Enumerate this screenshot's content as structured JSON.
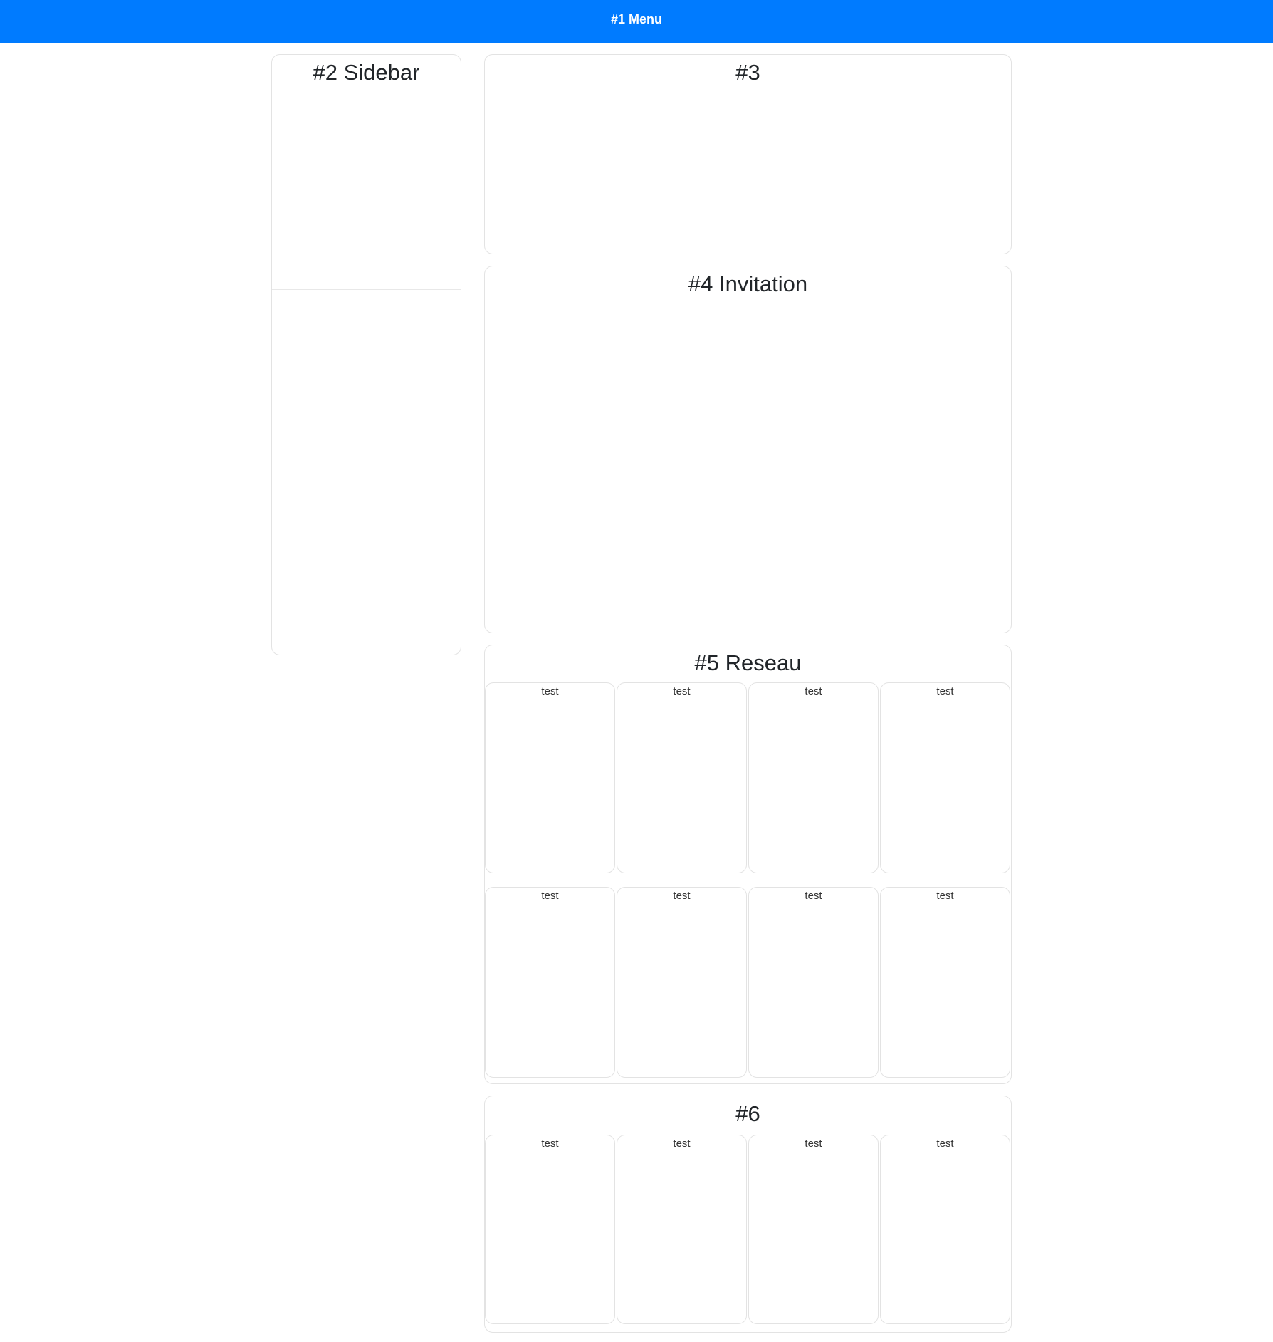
{
  "menu": {
    "label": "#1 Menu"
  },
  "sidebar": {
    "title": "#2 Sidebar"
  },
  "section3": {
    "title": "#3"
  },
  "section4": {
    "title": "#4 Invitation"
  },
  "section5": {
    "title": "#5 Reseau",
    "cards": [
      "test",
      "test",
      "test",
      "test",
      "test",
      "test",
      "test",
      "test"
    ]
  },
  "section6": {
    "title": "#6",
    "cards": [
      "test",
      "test",
      "test",
      "test"
    ]
  }
}
